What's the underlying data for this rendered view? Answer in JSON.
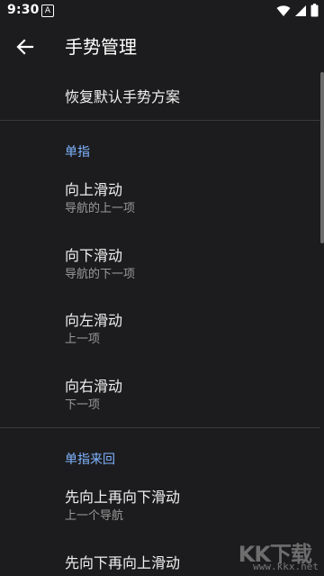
{
  "status_bar": {
    "time": "9:30",
    "notification_icon": "A"
  },
  "app_bar": {
    "title": "手势管理"
  },
  "reset": {
    "label": "恢复默认手势方案"
  },
  "sections": [
    {
      "header": "单指",
      "items": [
        {
          "title": "向上滑动",
          "subtitle": "导航的上一项"
        },
        {
          "title": "向下滑动",
          "subtitle": "导航的下一项"
        },
        {
          "title": "向左滑动",
          "subtitle": "上一项"
        },
        {
          "title": "向右滑动",
          "subtitle": "下一项"
        }
      ]
    },
    {
      "header": "单指来回",
      "items": [
        {
          "title": "先向上再向下滑动",
          "subtitle": "上一个导航"
        },
        {
          "title": "先向下再向上滑动",
          "subtitle": ""
        }
      ]
    }
  ],
  "watermark": {
    "logo": "KK下载",
    "url": "www.kkx.net"
  },
  "colors": {
    "background": "#1c1c1e",
    "accent": "#7fb3ff",
    "divider": "#3a3a3c"
  }
}
